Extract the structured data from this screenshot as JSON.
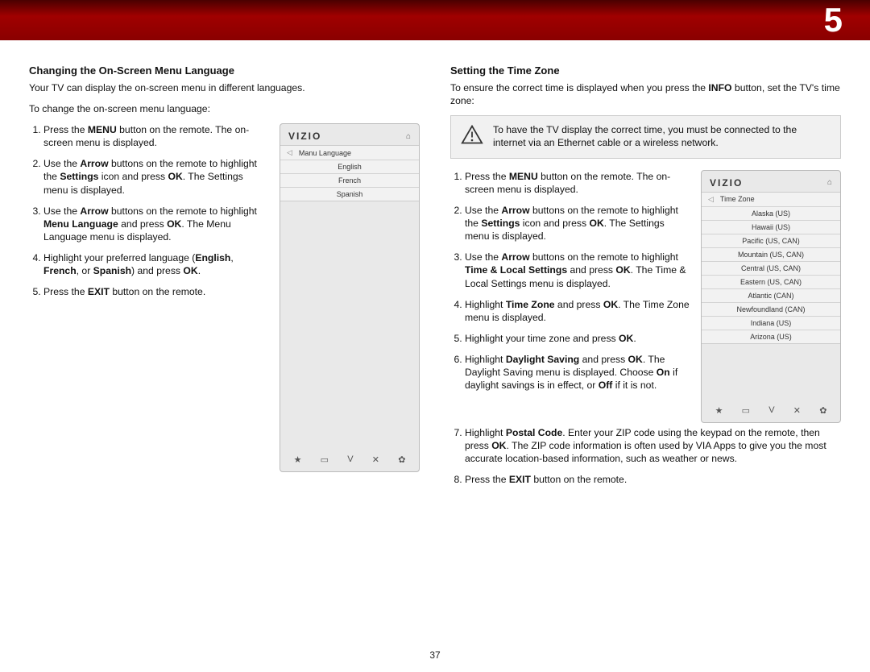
{
  "chapter_number": "5",
  "page_number": "37",
  "left": {
    "heading": "Changing the On-Screen Menu Language",
    "intro1": "Your TV can display the on-screen menu in different languages.",
    "intro2": "To change the on-screen menu language:",
    "step1_a": "Press the ",
    "step1_b": "MENU",
    "step1_c": " button on the remote. The on-screen menu is displayed.",
    "step2_a": "Use the ",
    "step2_b": "Arrow",
    "step2_c": " buttons on the remote to highlight the ",
    "step2_d": "Settings",
    "step2_e": " icon and press ",
    "step2_f": "OK",
    "step2_g": ". The Settings menu is displayed.",
    "step3_a": "Use the ",
    "step3_b": "Arrow",
    "step3_c": " buttons on the remote to highlight ",
    "step3_d": "Menu Language",
    "step3_e": " and press ",
    "step3_f": "OK",
    "step3_g": ". The Menu Language menu is displayed.",
    "step4_a": "Highlight your preferred language (",
    "step4_b": "English",
    "step4_c": ", ",
    "step4_d": "French",
    "step4_e": ", or ",
    "step4_f": "Spanish",
    "step4_g": ") and press ",
    "step4_h": "OK",
    "step4_i": ".",
    "step5_a": "Press the ",
    "step5_b": "EXIT",
    "step5_c": " button on the remote.",
    "screen": {
      "brand": "VIZIO",
      "home_icon": "⌂",
      "menu_title": "Manu Language",
      "items": [
        "English",
        "French",
        "Spanish"
      ],
      "foot_icons": [
        "★",
        "▭",
        "V",
        "✕",
        "✿"
      ]
    }
  },
  "right": {
    "heading": "Setting the Time Zone",
    "intro_a": "To ensure the correct time is displayed when you press the ",
    "intro_b": "INFO",
    "intro_c": " button, set the TV's time zone:",
    "warning": "To have the TV display the correct time, you must be connected to the internet via an Ethernet cable or a wireless network.",
    "step1_a": "Press the ",
    "step1_b": "MENU",
    "step1_c": " button on the remote. The on-screen menu is displayed.",
    "step2_a": "Use the ",
    "step2_b": "Arrow",
    "step2_c": " buttons on the remote to highlight the ",
    "step2_d": "Settings",
    "step2_e": " icon and press ",
    "step2_f": "OK",
    "step2_g": ". The Settings menu is displayed.",
    "step3_a": "Use the ",
    "step3_b": "Arrow",
    "step3_c": " buttons on the remote to highlight ",
    "step3_d": "Time & Local Settings",
    "step3_e": " and press ",
    "step3_f": "OK",
    "step3_g": ". The Time & Local Settings menu is displayed.",
    "step4_a": "Highlight ",
    "step4_b": "Time Zone",
    "step4_c": " and press ",
    "step4_d": "OK",
    "step4_e": ". The Time Zone menu is displayed.",
    "step5_a": "Highlight your time zone and press ",
    "step5_b": "OK",
    "step5_c": ".",
    "step6_a": "Highlight ",
    "step6_b": "Daylight Saving",
    "step6_c": " and press ",
    "step6_d": "OK",
    "step6_e": ". The Daylight Saving menu is displayed. Choose ",
    "step6_f": "On",
    "step6_g": " if daylight savings is in effect, or ",
    "step6_h": "Off",
    "step6_i": " if it is not.",
    "step7_a": "Highlight ",
    "step7_b": "Postal Code",
    "step7_c": ". Enter your ZIP code using the keypad on the remote, then press ",
    "step7_d": "OK",
    "step7_e": ". The ZIP code information is often used by VIA Apps to give you the most accurate location-based information, such as weather or news.",
    "step8_a": "Press the ",
    "step8_b": "EXIT",
    "step8_c": " button on the remote.",
    "screen": {
      "brand": "VIZIO",
      "home_icon": "⌂",
      "menu_title": "Time Zone",
      "items": [
        "Alaska (US)",
        "Hawaii (US)",
        "Pacific (US, CAN)",
        "Mountain (US, CAN)",
        "Central (US, CAN)",
        "Eastern (US, CAN)",
        "Atlantic (CAN)",
        "Newfoundland (CAN)",
        "Indiana (US)",
        "Arizona (US)"
      ],
      "foot_icons": [
        "★",
        "▭",
        "V",
        "✕",
        "✿"
      ]
    }
  }
}
